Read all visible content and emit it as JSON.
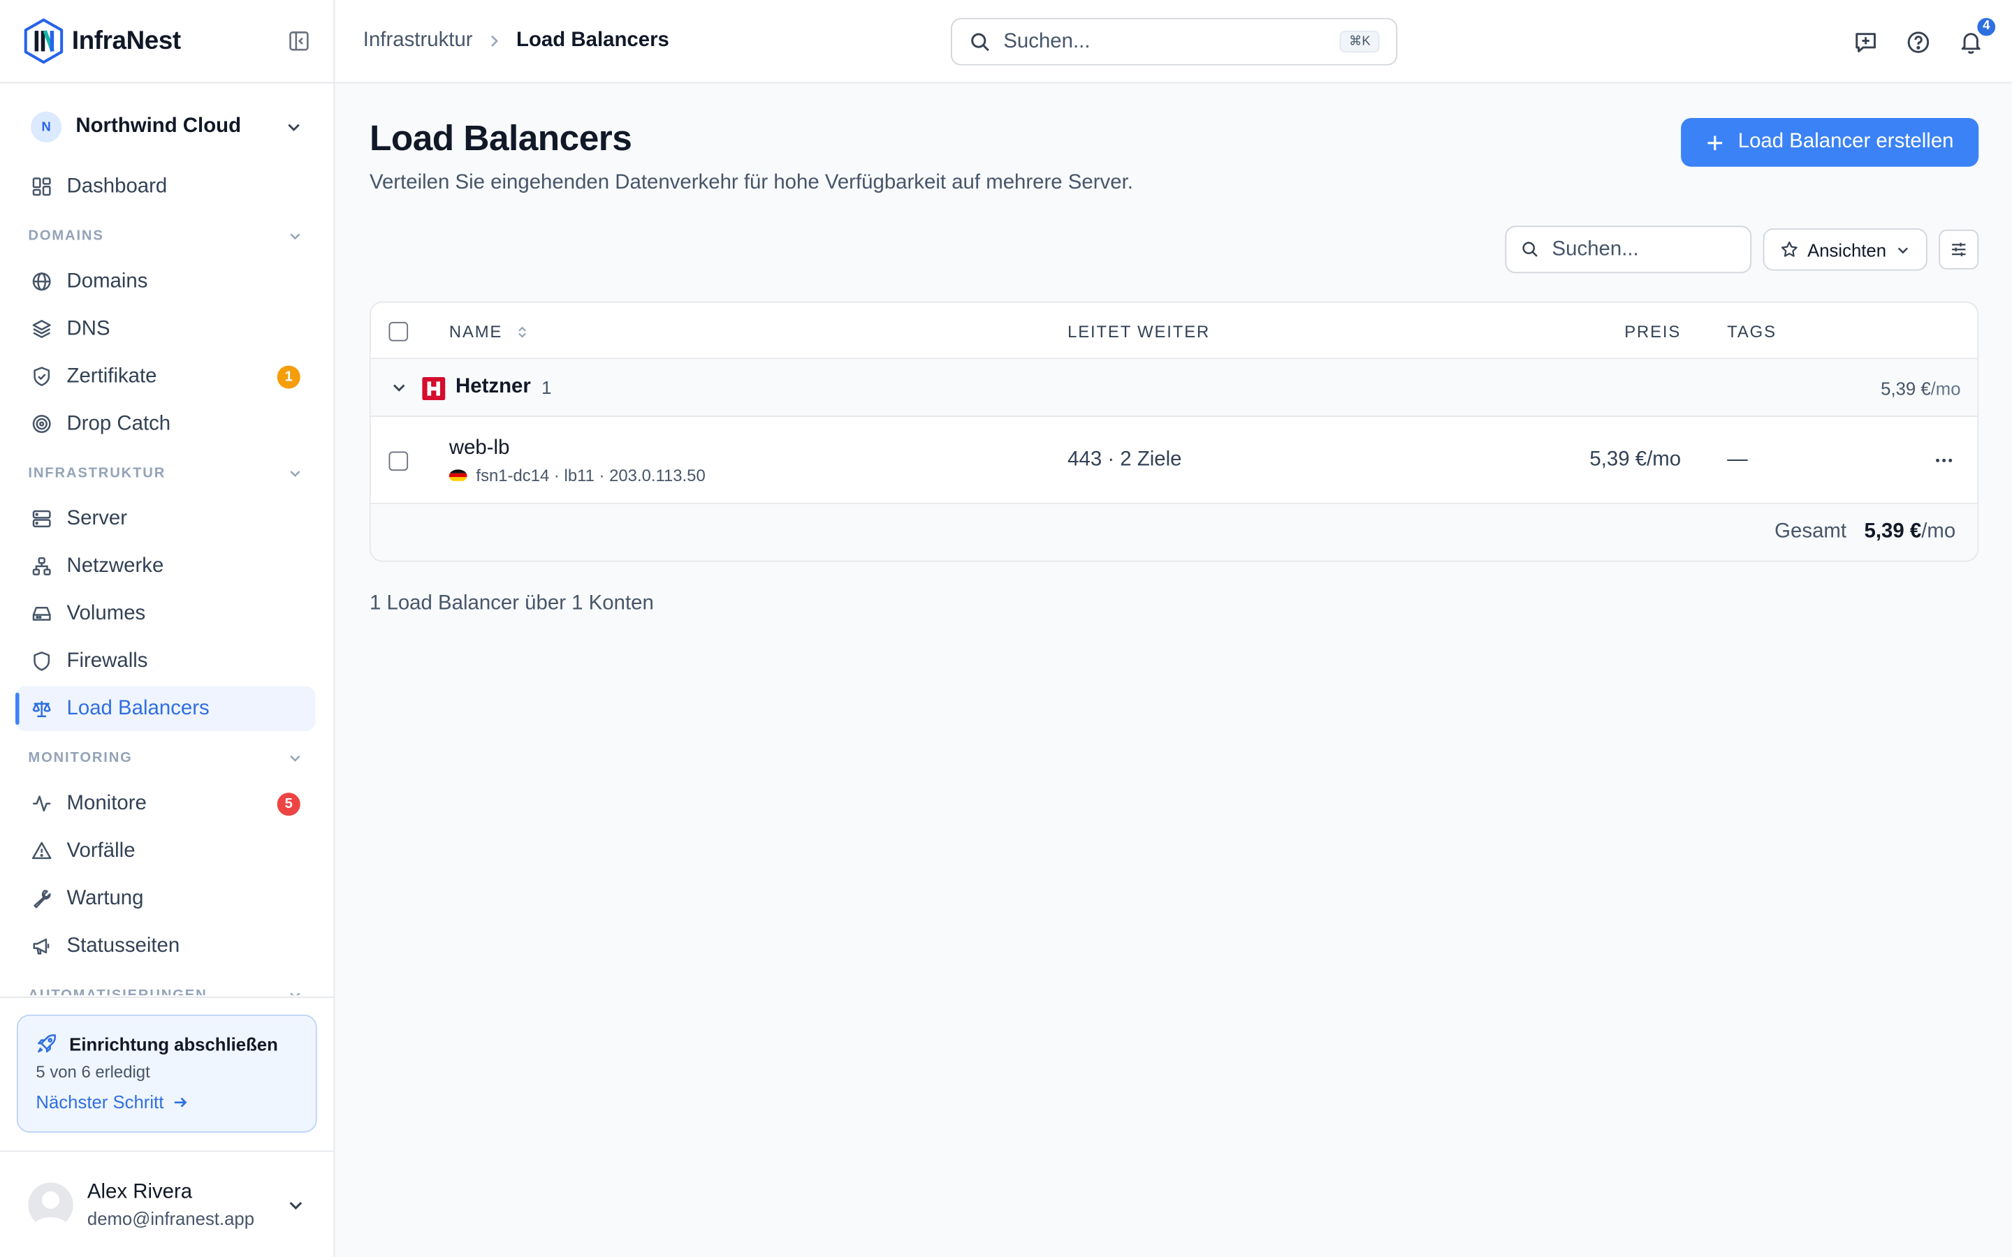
{
  "app": {
    "name": "InfraNest"
  },
  "org": {
    "initial": "N",
    "name": "Northwind Cloud"
  },
  "sidebar": {
    "dashboard": {
      "label": "Dashboard"
    },
    "sections": {
      "domains": "DOMAINS",
      "infra": "INFRASTRUKTUR",
      "monitoring": "MONITORING",
      "automation": "AUTOMATISIERUNGEN"
    },
    "domains_items": [
      {
        "label": "Domains"
      },
      {
        "label": "DNS"
      },
      {
        "label": "Zertifikate",
        "badge": "1"
      },
      {
        "label": "Drop Catch"
      }
    ],
    "infra_items": [
      {
        "label": "Server"
      },
      {
        "label": "Netzwerke"
      },
      {
        "label": "Volumes"
      },
      {
        "label": "Firewalls"
      },
      {
        "label": "Load Balancers",
        "active": true
      }
    ],
    "monitoring_items": [
      {
        "label": "Monitore",
        "badge": "5"
      },
      {
        "label": "Vorfälle"
      },
      {
        "label": "Wartung"
      },
      {
        "label": "Statusseiten"
      }
    ]
  },
  "setup": {
    "title": "Einrichtung abschließen",
    "progress": "5 von 6 erledigt",
    "next": "Nächster Schritt"
  },
  "user": {
    "name": "Alex Rivera",
    "email": "demo@infranest.app"
  },
  "topbar": {
    "breadcrumb_parent": "Infrastruktur",
    "breadcrumb_current": "Load Balancers",
    "search_placeholder": "Suchen...",
    "search_shortcut": "⌘K",
    "notifications_count": "4"
  },
  "page": {
    "title": "Load Balancers",
    "subtitle": "Verteilen Sie eingehenden Datenverkehr für hohe Verfügbarkeit auf mehrere Server.",
    "create_label": "Load Balancer erstellen",
    "table_search_placeholder": "Suchen...",
    "views_label": "Ansichten"
  },
  "table": {
    "columns": {
      "name": "NAME",
      "forwards": "LEITET WEITER",
      "price": "PREIS",
      "tags": "TAGS"
    },
    "group": {
      "name": "Hetzner",
      "count": "1",
      "price": "5,39 €",
      "price_unit": "/mo"
    },
    "rows": [
      {
        "name": "web-lb",
        "meta": "fsn1-dc14 · lb11 · 203.0.113.50",
        "forwards": "443 · 2 Ziele",
        "price": "5,39 €/mo",
        "tags": "—"
      }
    ],
    "total_label": "Gesamt",
    "total_value": "5,39 €",
    "total_unit": "/mo"
  },
  "summary": "1 Load Balancer über 1 Konten",
  "colors": {
    "accent": "#3b82f6",
    "badge_warning": "#f59e0b",
    "badge_danger": "#ef4444",
    "hetzner": "#d50c2d"
  }
}
